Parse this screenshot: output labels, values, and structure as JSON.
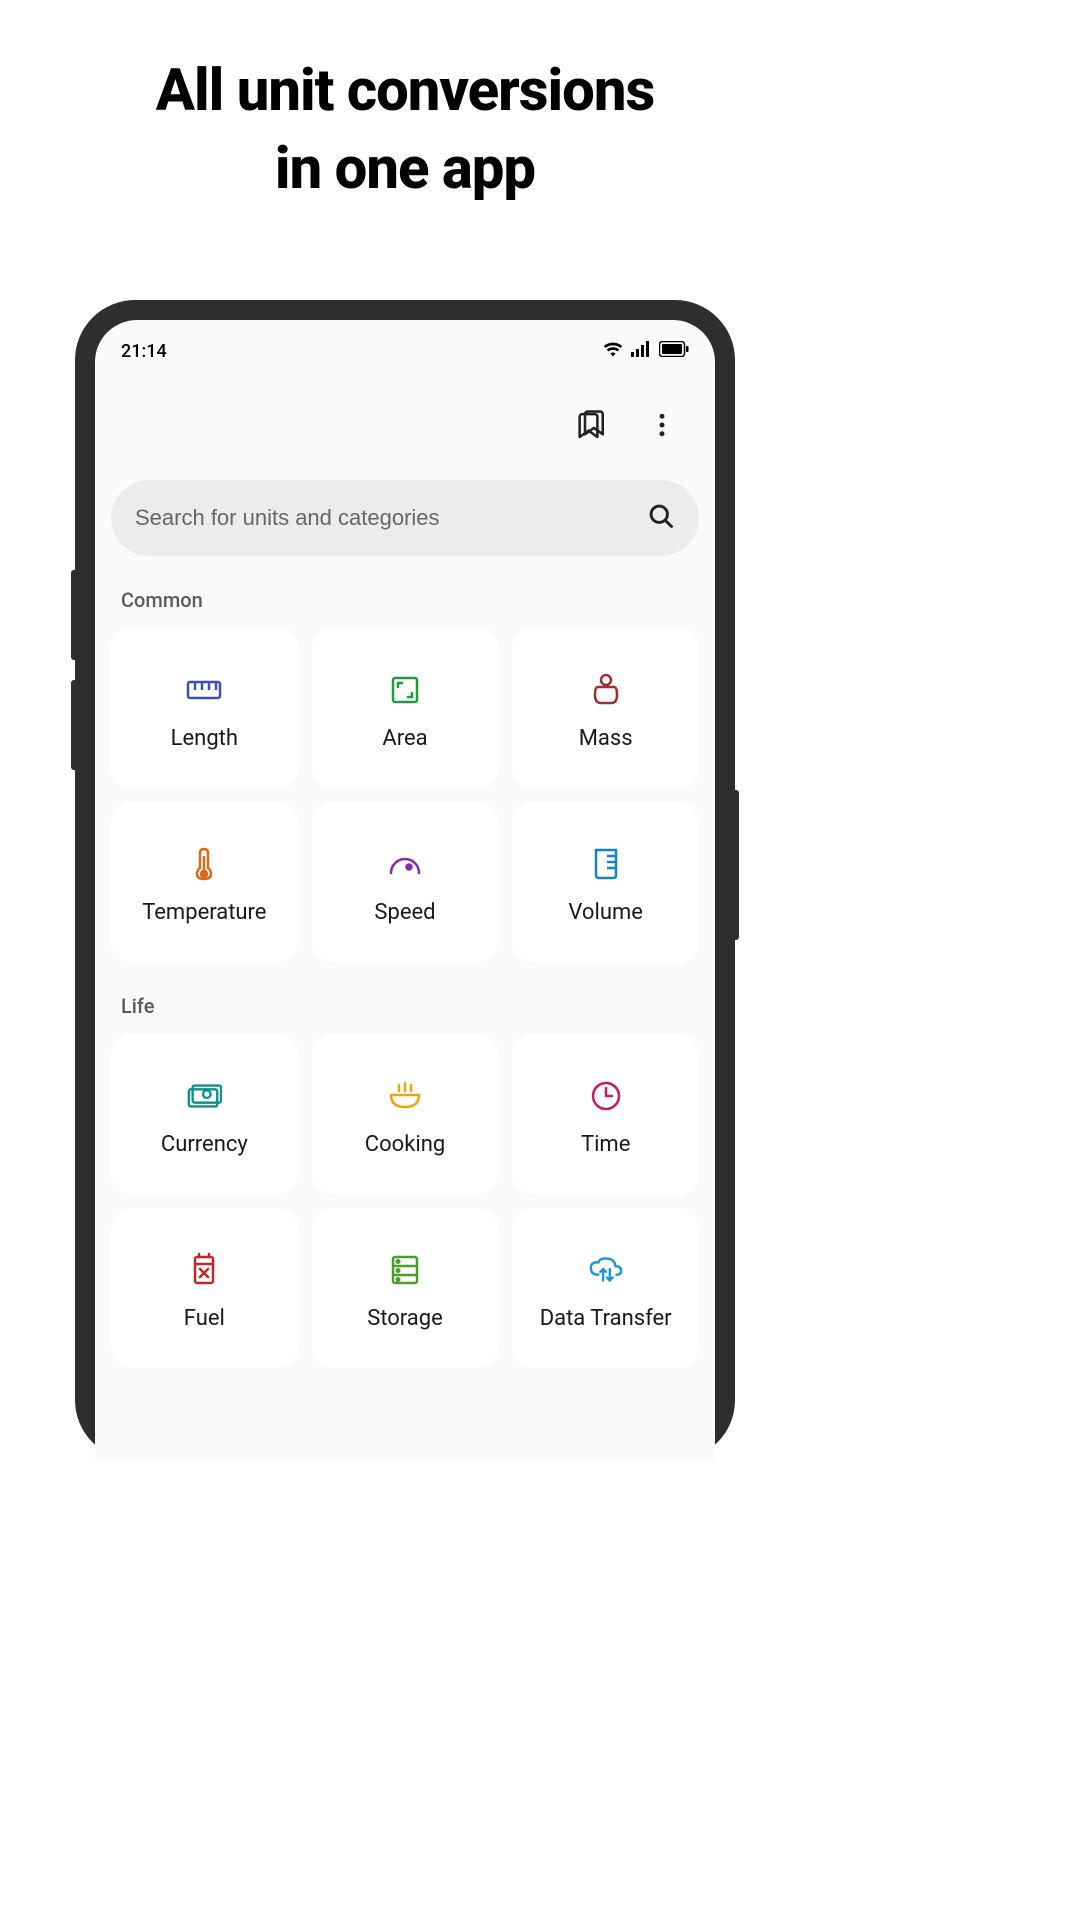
{
  "headline_line1": "All unit conversions",
  "headline_line2": "in one app",
  "status": {
    "time": "21:14"
  },
  "search": {
    "placeholder": "Search for units and categories"
  },
  "sections": {
    "common": {
      "title": "Common",
      "items": [
        {
          "label": "Length"
        },
        {
          "label": "Area"
        },
        {
          "label": "Mass"
        },
        {
          "label": "Temperature"
        },
        {
          "label": "Speed"
        },
        {
          "label": "Volume"
        }
      ]
    },
    "life": {
      "title": "Life",
      "items": [
        {
          "label": "Currency"
        },
        {
          "label": "Cooking"
        },
        {
          "label": "Time"
        },
        {
          "label": "Fuel"
        },
        {
          "label": "Storage"
        },
        {
          "label": "Data Transfer"
        }
      ]
    }
  },
  "colors": {
    "length": "#3a4fb8",
    "area": "#1f9c3a",
    "mass": "#a03030",
    "temperature": "#d86a1e",
    "speed": "#8c27a8",
    "volume": "#1086c7",
    "currency": "#0a9088",
    "cooking": "#e8a80c",
    "time": "#c41c5c",
    "fuel": "#c22626",
    "storage": "#4a9c2c",
    "datatransfer": "#1a96d4"
  }
}
